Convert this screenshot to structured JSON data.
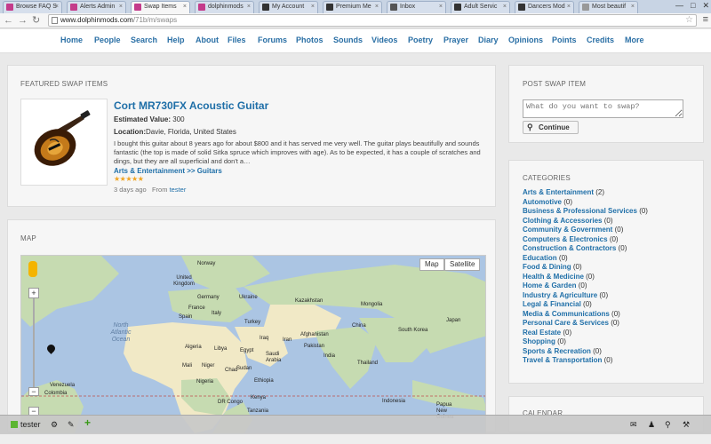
{
  "browser": {
    "tabs": [
      {
        "label": "Browse FAQ S",
        "color": "#c43b8b"
      },
      {
        "label": "Alerts Admin",
        "color": "#c43b8b"
      },
      {
        "label": "Swap Items",
        "color": "#c43b8b"
      },
      {
        "label": "dolphinmods",
        "color": "#c43b8b"
      },
      {
        "label": "My Account",
        "color": "#333333"
      },
      {
        "label": "Premium Me",
        "color": "#333333"
      },
      {
        "label": "Inbox",
        "color": "#555555"
      },
      {
        "label": "Adult Servic",
        "color": "#333333"
      },
      {
        "label": "Dancers Mod",
        "color": "#333333"
      },
      {
        "label": "Most beautif",
        "color": "#999999"
      }
    ],
    "active_tab": 2,
    "url_host": "www.dolphinmods.com",
    "url_path": "/71b/m/swaps"
  },
  "nav": {
    "items": [
      "Home",
      "People",
      "Search",
      "Help",
      "About",
      "Files",
      "Forums",
      "Photos",
      "Sounds",
      "Videos",
      "Poetry",
      "Prayer",
      "Diary",
      "Opinions",
      "Points",
      "Credits",
      "More"
    ]
  },
  "featured": {
    "heading": "FEATURED SWAP ITEMS",
    "title": "Cort MR730FX Acoustic Guitar",
    "est_label": "Estimated Value:",
    "est_value": "300",
    "loc_label": "Location:",
    "loc_value": "Davie, Florida, United States",
    "description": "I bought this guitar about 8 years ago for about $800 and it has served me very well. The guitar plays beautifully and sounds fantastic (the top is made of solid Sitka spruce which improves with age). As to be expected, it has a couple of scratches and dings, but they are all superficial and don't a…",
    "category": "Arts & Entertainment >> Guitars",
    "rating": 5,
    "posted": "3 days ago",
    "from_label": "From",
    "author": "tester"
  },
  "map": {
    "heading": "MAP",
    "type_map": "Map",
    "type_satellite": "Satellite",
    "labels": {
      "norway": "Norway",
      "uk": "United Kingdom",
      "germany": "Germany",
      "ukraine": "Ukraine",
      "france": "France",
      "kazakhstan": "Kazakhstan",
      "mongolia": "Mongolia",
      "spain": "Spain",
      "italy": "Italy",
      "turkey": "Turkey",
      "china": "China",
      "japan": "Japan",
      "southkorea": "South Korea",
      "iran": "Iran",
      "iraq": "Iraq",
      "afghanistan": "Afghanistan",
      "pakistan": "Pakistan",
      "algeria": "Algeria",
      "libya": "Libya",
      "egypt": "Egypt",
      "saudi": "Saudi Arabia",
      "india": "India",
      "thailand": "Thailand",
      "mali": "Mali",
      "niger": "Niger",
      "chad": "Chad",
      "sudan": "Sudan",
      "nigeria": "Nigeria",
      "ethiopia": "Ethiopia",
      "venezuela": "Venezuela",
      "colombia": "Colombia",
      "drcongo": "DR Congo",
      "kenya": "Kenya",
      "tanzania": "Tanzania",
      "indonesia": "Indonesia",
      "png": "Papua New Guinea",
      "ocean": "North Atlantic Ocean"
    }
  },
  "post_swap": {
    "heading": "POST SWAP ITEM",
    "placeholder": "What do you want to swap?",
    "button": "Continue"
  },
  "categories": {
    "heading": "CATEGORIES",
    "items": [
      {
        "name": "Arts & Entertainment",
        "count": "(2)"
      },
      {
        "name": "Automotive",
        "count": "(0)"
      },
      {
        "name": "Business & Professional Services",
        "count": "(0)"
      },
      {
        "name": "Clothing & Accessories",
        "count": "(0)"
      },
      {
        "name": "Community & Government",
        "count": "(0)"
      },
      {
        "name": "Computers & Electronics",
        "count": "(0)"
      },
      {
        "name": "Construction & Contractors",
        "count": "(0)"
      },
      {
        "name": "Education",
        "count": "(0)"
      },
      {
        "name": "Food & Dining",
        "count": "(0)"
      },
      {
        "name": "Health & Medicine",
        "count": "(0)"
      },
      {
        "name": "Home & Garden",
        "count": "(0)"
      },
      {
        "name": "Industry & Agriculture",
        "count": "(0)"
      },
      {
        "name": "Legal & Financial",
        "count": "(0)"
      },
      {
        "name": "Media & Communications",
        "count": "(0)"
      },
      {
        "name": "Personal Care & Services",
        "count": "(0)"
      },
      {
        "name": "Real Estate",
        "count": "(0)"
      },
      {
        "name": "Shopping",
        "count": "(0)"
      },
      {
        "name": "Sports & Recreation",
        "count": "(0)"
      },
      {
        "name": "Travel & Transportation",
        "count": "(0)"
      }
    ]
  },
  "calendar": {
    "heading": "CALENDAR"
  },
  "bottombar": {
    "user": "tester",
    "accent": "#5cb531"
  }
}
